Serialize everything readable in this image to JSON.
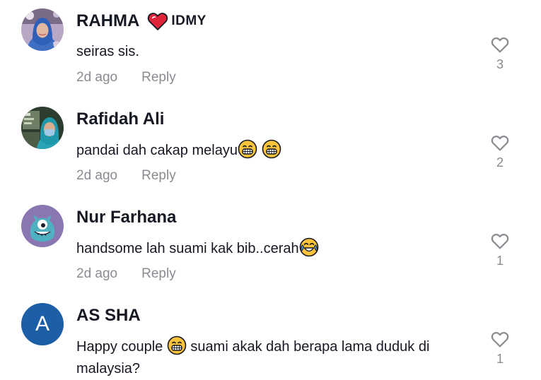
{
  "comments": [
    {
      "username": "RAHMA",
      "badge_text": "IDMY",
      "text": "seiras sis.",
      "time": "2d ago",
      "reply_label": "Reply",
      "likes": "3",
      "avatar_icon": "hijab-woman-photo"
    },
    {
      "username": "Rafidah Ali",
      "text": "pandai dah cakap melayu",
      "emojis": [
        "grinning-face-emoji",
        "grinning-face-emoji"
      ],
      "time": "2d ago",
      "reply_label": "Reply",
      "likes": "2",
      "avatar_icon": "woman-photo"
    },
    {
      "username": "Nur Farhana",
      "text": "handsome lah suami kak bib..cerah",
      "emojis": [
        "tears-of-joy-emoji"
      ],
      "time": "2d ago",
      "reply_label": "Reply",
      "likes": "1",
      "avatar_icon": "monster-cartoon"
    },
    {
      "username": "AS SHA",
      "avatar_letter": "A",
      "text_before": "Happy couple ",
      "text_after": " suami akak dah berapa lama duduk di malaysia?",
      "emojis": [
        "grinning-face-emoji"
      ],
      "time": "",
      "likes": "1",
      "avatar_color": "#1d5fa6"
    }
  ],
  "colors": {
    "text": "#161823",
    "muted": "#8a8b91",
    "heart_badge": "#e0243a",
    "emoji": "#fbc43a"
  }
}
